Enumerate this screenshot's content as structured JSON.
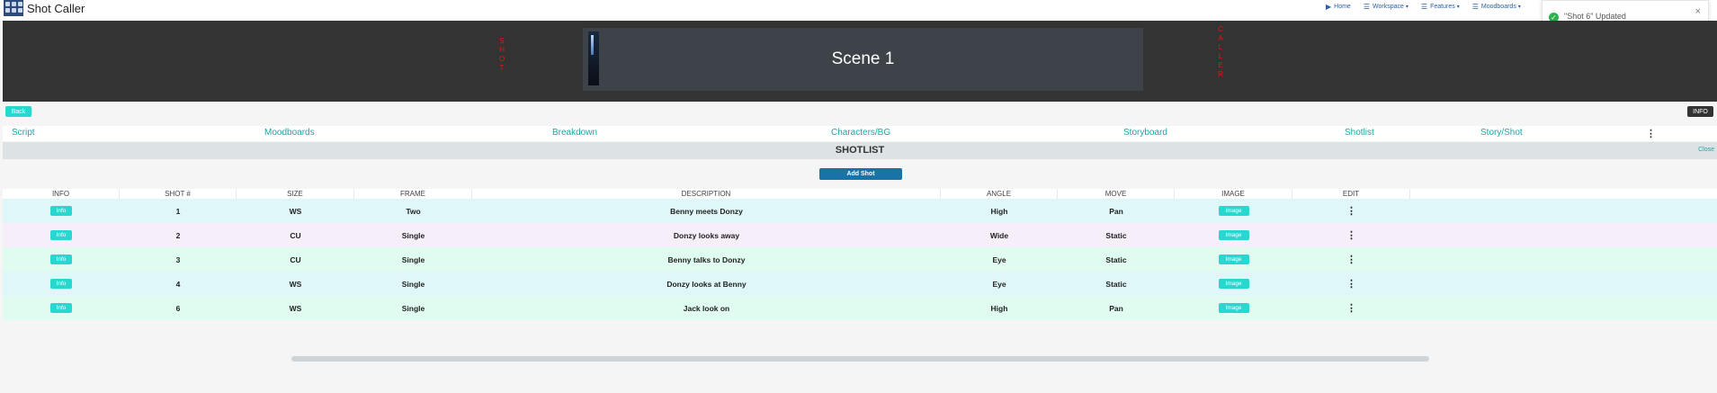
{
  "app": {
    "title": "Shot Caller"
  },
  "nav": {
    "items": [
      {
        "label": "Home",
        "icon": "play-icon"
      },
      {
        "label": "Workspace",
        "icon": "list-icon"
      },
      {
        "label": "Features",
        "icon": "list-icon"
      },
      {
        "label": "Moodboards",
        "icon": "list-icon"
      }
    ]
  },
  "toast": {
    "message": "\"Shot 6\" Updated",
    "close": "×"
  },
  "banner": {
    "left_letters": [
      "S",
      "H",
      "O",
      "T"
    ],
    "right_letters": [
      "C",
      "A",
      "L",
      "L",
      "E",
      "R"
    ],
    "scene_title": "Scene 1"
  },
  "buttons": {
    "back": "Back",
    "info": "INFO",
    "add_shot": "Add Shot",
    "close": "Close"
  },
  "tabs": [
    "Script",
    "Moodboards",
    "Breakdown",
    "Characters/BG",
    "Storyboard",
    "Shotlist",
    "Story/Shot"
  ],
  "section_title": "SHOTLIST",
  "table": {
    "columns": [
      "INFO",
      "SHOT #",
      "SIZE",
      "FRAME",
      "DESCRIPTION",
      "ANGLE",
      "MOVE",
      "IMAGE",
      "EDIT"
    ],
    "rows": [
      {
        "info": "Info",
        "shot": "1",
        "size": "WS",
        "frame": "Two",
        "description": "Benny meets Donzy",
        "angle": "High",
        "move": "Pan",
        "image": "Image",
        "bg": "#dff7f9"
      },
      {
        "info": "Info",
        "shot": "2",
        "size": "CU",
        "frame": "Single",
        "description": "Donzy looks away",
        "angle": "Wide",
        "move": "Static",
        "image": "Image",
        "bg": "#f6eef8"
      },
      {
        "info": "Info",
        "shot": "3",
        "size": "CU",
        "frame": "Single",
        "description": "Benny talks to Donzy",
        "angle": "Eye",
        "move": "Static",
        "image": "Image",
        "bg": "#e0fbef"
      },
      {
        "info": "Info",
        "shot": "4",
        "size": "WS",
        "frame": "Single",
        "description": "Donzy looks at Benny",
        "angle": "Eye",
        "move": "Static",
        "image": "Image",
        "bg": "#dff7f9"
      },
      {
        "info": "Info",
        "shot": "6",
        "size": "WS",
        "frame": "Single",
        "description": "Jack look on",
        "angle": "High",
        "move": "Pan",
        "image": "Image",
        "bg": "#e0fbef"
      }
    ]
  },
  "colors": {
    "accent": "#28d7d0",
    "primary": "#1773a8",
    "banner": "#333333",
    "tab_text": "#1aa7a7",
    "red_text": "#ee1111",
    "success": "#2bb24c"
  }
}
